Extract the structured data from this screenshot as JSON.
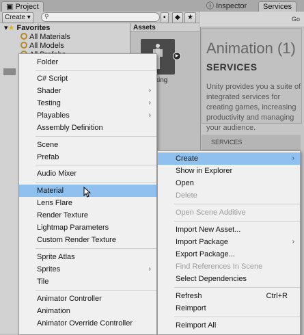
{
  "tabs": {
    "project": "Project",
    "inspector": "Inspector",
    "services": "Services"
  },
  "toolbar": {
    "create_label": "Create",
    "search_placeholder": ""
  },
  "favorites": {
    "header": "Favorites",
    "items": [
      "All Materials",
      "All Models",
      "All Prefabs"
    ]
  },
  "assets": {
    "header": "Assets",
    "item_label": "king"
  },
  "services": {
    "go_label": "Go",
    "title": "Animation (1)",
    "heading": "SERVICES",
    "description": "Unity provides you a suite of integrated services for creating games, increasing productivity and managing your audience.",
    "tab_label": "SERVICES"
  },
  "create_menu": {
    "items": [
      {
        "label": "Folder"
      },
      {
        "label": "C# Script"
      },
      {
        "label": "Shader",
        "submenu": true
      },
      {
        "label": "Testing",
        "submenu": true
      },
      {
        "label": "Playables",
        "submenu": true
      },
      {
        "label": "Assembly Definition"
      },
      {
        "label": "Scene"
      },
      {
        "label": "Prefab"
      },
      {
        "label": "Audio Mixer"
      },
      {
        "label": "Material",
        "highlighted": true
      },
      {
        "label": "Lens Flare"
      },
      {
        "label": "Render Texture"
      },
      {
        "label": "Lightmap Parameters"
      },
      {
        "label": "Custom Render Texture"
      },
      {
        "label": "Sprite Atlas"
      },
      {
        "label": "Sprites",
        "submenu": true
      },
      {
        "label": "Tile"
      },
      {
        "label": "Animator Controller"
      },
      {
        "label": "Animation"
      },
      {
        "label": "Animator Override Controller"
      }
    ]
  },
  "assets_menu": {
    "items": [
      {
        "label": "Create",
        "submenu": true,
        "highlighted": true
      },
      {
        "label": "Show in Explorer"
      },
      {
        "label": "Open"
      },
      {
        "label": "Delete",
        "disabled": true
      },
      {
        "label": "Open Scene Additive",
        "disabled": true
      },
      {
        "label": "Import New Asset..."
      },
      {
        "label": "Import Package",
        "submenu": true
      },
      {
        "label": "Export Package..."
      },
      {
        "label": "Find References In Scene",
        "disabled": true
      },
      {
        "label": "Select Dependencies"
      },
      {
        "label": "Refresh",
        "shortcut": "Ctrl+R"
      },
      {
        "label": "Reimport"
      },
      {
        "label": "Reimport All"
      }
    ]
  },
  "colors": {
    "highlight": "#8fc0ee",
    "menu_bg": "#f0f0f0",
    "panel_bg": "#c2c2c2"
  }
}
